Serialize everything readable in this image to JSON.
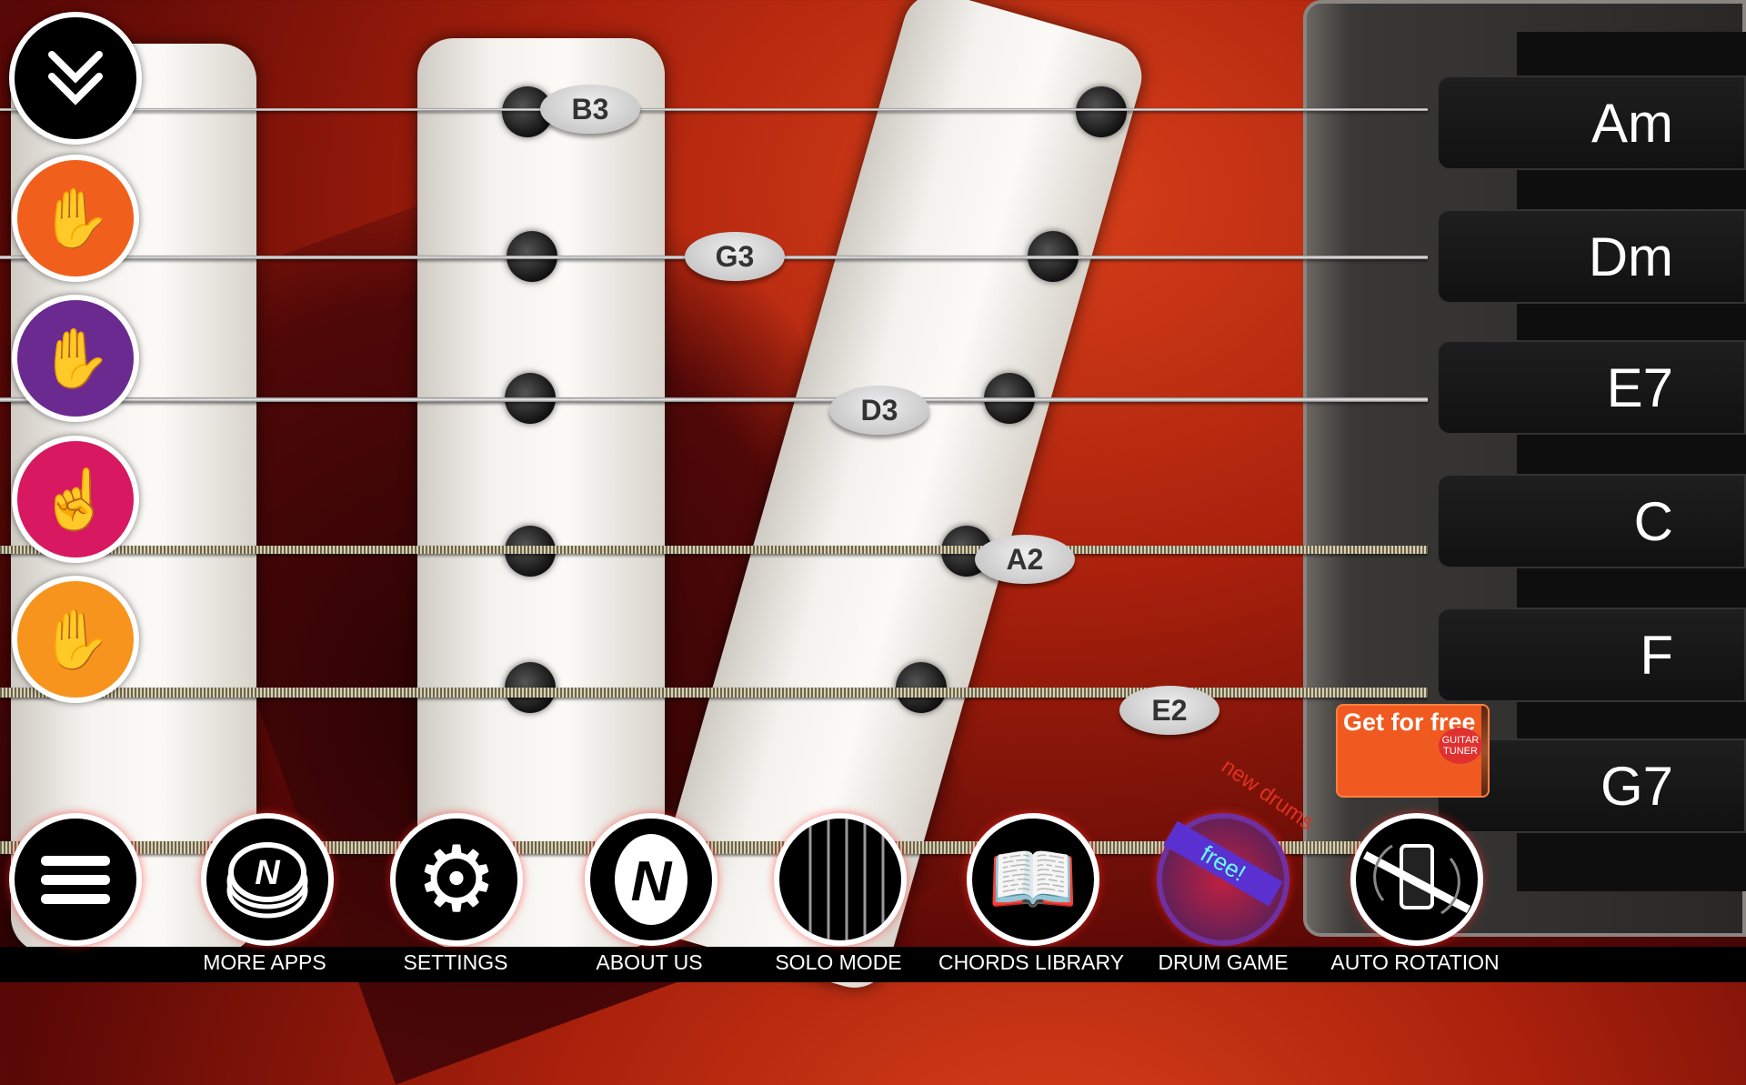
{
  "left_controls": [
    {
      "name": "collapse",
      "icon": "double-chevron-down-icon",
      "color": "#000000"
    },
    {
      "name": "strum-down",
      "icon": "hand-swipe-icon",
      "color": "#f0601c"
    },
    {
      "name": "strum-up",
      "icon": "hand-swipe-icon",
      "color": "#6a2a90"
    },
    {
      "name": "pick",
      "icon": "finger-pick-icon",
      "color": "#d81860"
    },
    {
      "name": "mute",
      "icon": "open-hand-icon",
      "color": "#f7941d"
    }
  ],
  "strings": [
    "B3",
    "G3",
    "D3",
    "A2",
    "E2"
  ],
  "chords": [
    "Am",
    "Dm",
    "E7",
    "C",
    "F",
    "G7"
  ],
  "ad": {
    "text": "Get for free",
    "image_label": "GUITAR TUNER"
  },
  "drum_badge": {
    "banner": "free!",
    "arc": "new drums"
  },
  "toolbar": [
    {
      "label": "",
      "icon": "hamburger-menu-icon"
    },
    {
      "label": "MORE APPS",
      "icon": "coin-stack-icon"
    },
    {
      "label": "SETTINGS",
      "icon": "gear-icon"
    },
    {
      "label": "ABOUT US",
      "icon": "n-logo-icon"
    },
    {
      "label": "SOLO MODE",
      "icon": "strings-icon"
    },
    {
      "label": "CHORDS LIBRARY",
      "icon": "book-icon"
    },
    {
      "label": "DRUM GAME",
      "icon": "drum-icon"
    },
    {
      "label": "AUTO ROTATION",
      "icon": "rotation-lock-icon"
    }
  ]
}
